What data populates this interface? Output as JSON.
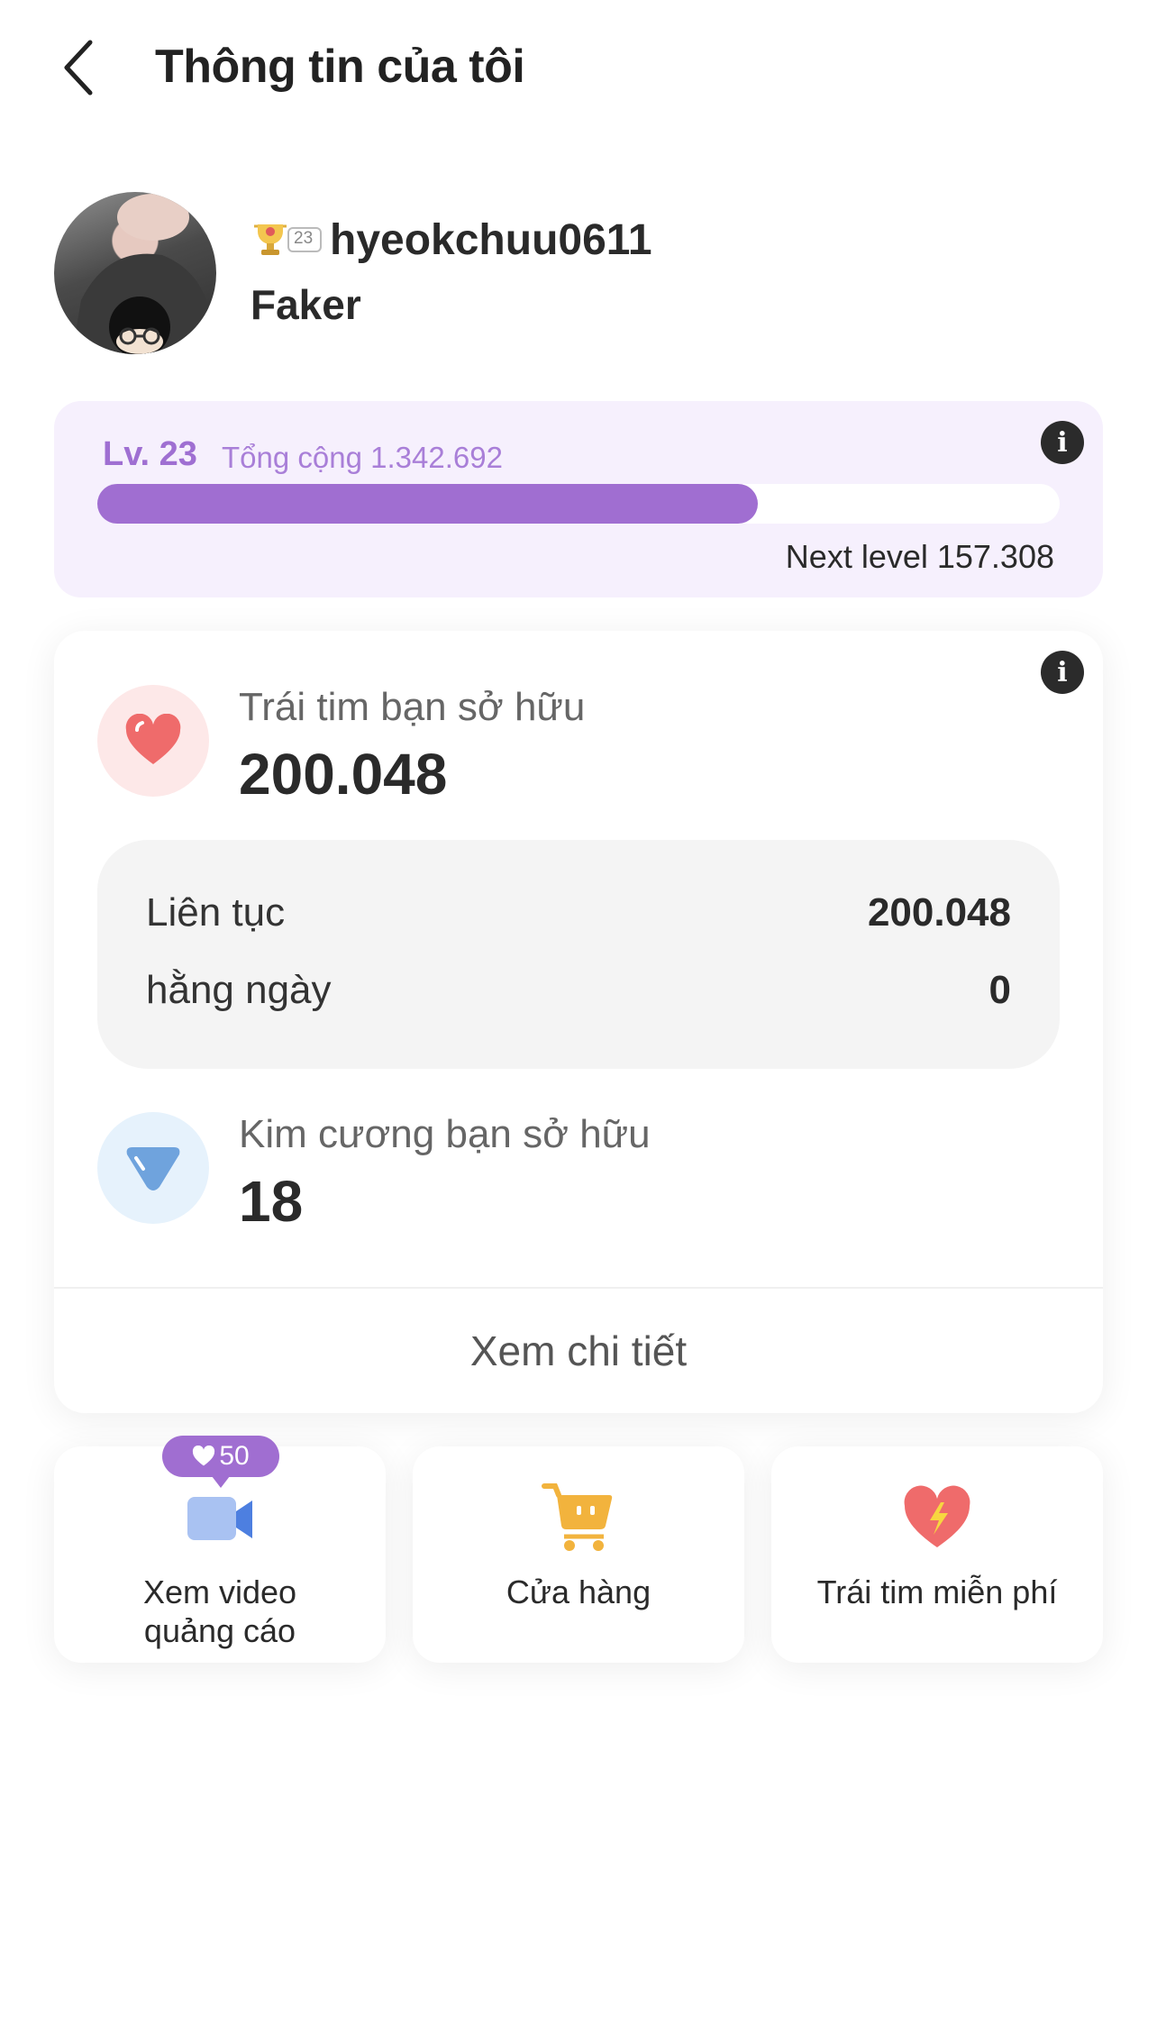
{
  "header": {
    "title": "Thông tin của tôi",
    "back_icon": "chevron-left-icon"
  },
  "profile": {
    "username": "hyeokchuu0611",
    "nickname": "Faker",
    "badge_level": "23",
    "badge_icon": "trophy-icon"
  },
  "level": {
    "level_label": "Lv. 23",
    "total_label": "Tổng cộng 1.342.692",
    "progress_fraction": 0.686,
    "next_level_label": "Next level 157.308",
    "accent_color": "#a06ed1"
  },
  "wallet": {
    "hearts": {
      "label": "Trái tim bạn sở hữu",
      "value": "200.048",
      "icon": "heart-icon",
      "color": "#ef6b6b"
    },
    "breakdown": [
      {
        "label": "Liên tục",
        "value": "200.048"
      },
      {
        "label": "hằng ngày",
        "value": "0"
      }
    ],
    "diamonds": {
      "label": "Kim cương bạn sở hữu",
      "value": "18",
      "icon": "diamond-icon",
      "color": "#6fa3dd"
    },
    "detail_link": "Xem chi tiết"
  },
  "actions": [
    {
      "label_line1": "Xem video",
      "label_line2": "quảng cáo",
      "icon": "video-camera-icon",
      "bubble": "50"
    },
    {
      "label_line1": "Cửa hàng",
      "icon": "shopping-cart-icon"
    },
    {
      "label_line1": "Trái tim miễn phí",
      "icon": "heart-lightning-icon"
    }
  ]
}
